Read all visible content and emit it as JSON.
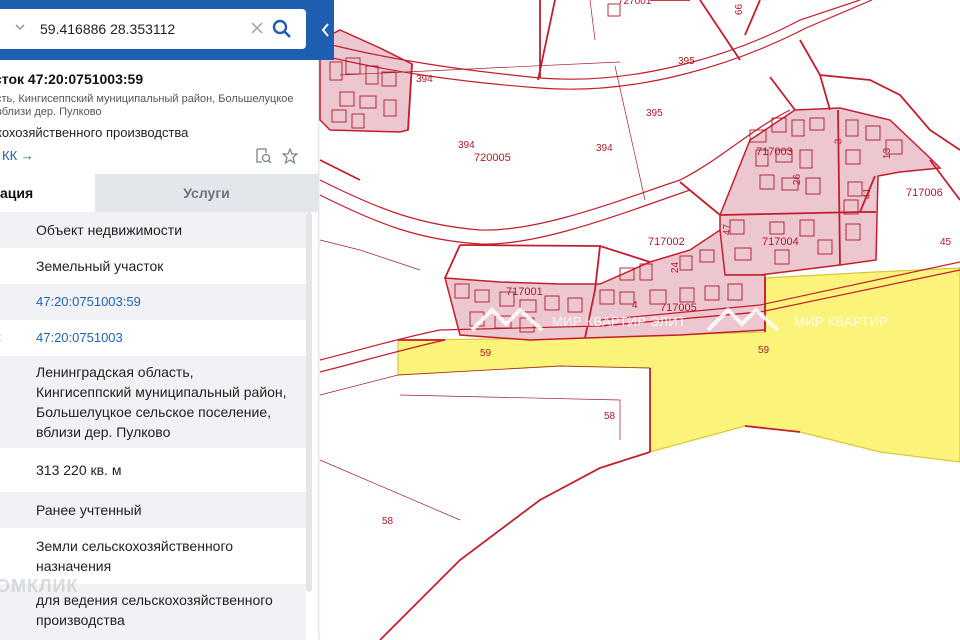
{
  "search": {
    "value": "59.416886 28.353112"
  },
  "parcel": {
    "title": "сток 47:20:0751003:59",
    "address_lines": [
      "сть, Кингисеппский муниципальный район, Большелуцкое",
      "вблизи дер. Пулково"
    ],
    "use": "кохозяйственного производства",
    "kk_link": "КК →"
  },
  "tabs": {
    "info": "ация",
    "services": "Услуги"
  },
  "rows": [
    {
      "label": "",
      "value": "Объект недвижимости"
    },
    {
      "label": "",
      "value": "Земельный участок"
    },
    {
      "label": "",
      "value": "47:20:0751003:59"
    },
    {
      "label": ":",
      "value": "47:20:0751003"
    },
    {
      "label": "",
      "value": "Ленинградская область,\nКингисеппский муниципальный район,\nБольшелуцкое сельское поселение,\nвблизи дер. Пулково"
    },
    {
      "label": "",
      "value": "313 220 кв. м"
    },
    {
      "label": "",
      "value": "Ранее учтенный"
    },
    {
      "label": "",
      "value": "Земли сельскохозяйственного\nназначения"
    },
    {
      "label": "",
      "value": "для ведения сельскохозяйственного\nпроизводства"
    }
  ],
  "map_labels": {
    "q727001": "727001",
    "n66": "66",
    "n394a": "394",
    "n395a": "395",
    "n395b": "395",
    "n394b": "394",
    "q720005": "720005",
    "n394c": "394",
    "q717003": "717003",
    "n3": "3",
    "n13": "13",
    "n26": "26",
    "n41": "41",
    "q717006": "717006",
    "n47": "47",
    "q717002": "717002",
    "q717004": "717004",
    "n45": "45",
    "n24": "24",
    "q717001": "717001",
    "n4": "4",
    "q717005": "717005",
    "n59a": "59",
    "n59b": "59",
    "n58a": "58",
    "n58b": "58"
  },
  "watermarks": {
    "a": "МИР КВАРТИР ЭЛИТ",
    "b": "МИР КВАРТИР",
    "bottom": "ОМКЛИК"
  },
  "colors": {
    "boundary": "#c41e2e",
    "quarter_fill": "#ecc7d0",
    "selected_fill": "#fbf37a",
    "panel_header": "#1f5fb0",
    "link": "#1f63b4"
  }
}
